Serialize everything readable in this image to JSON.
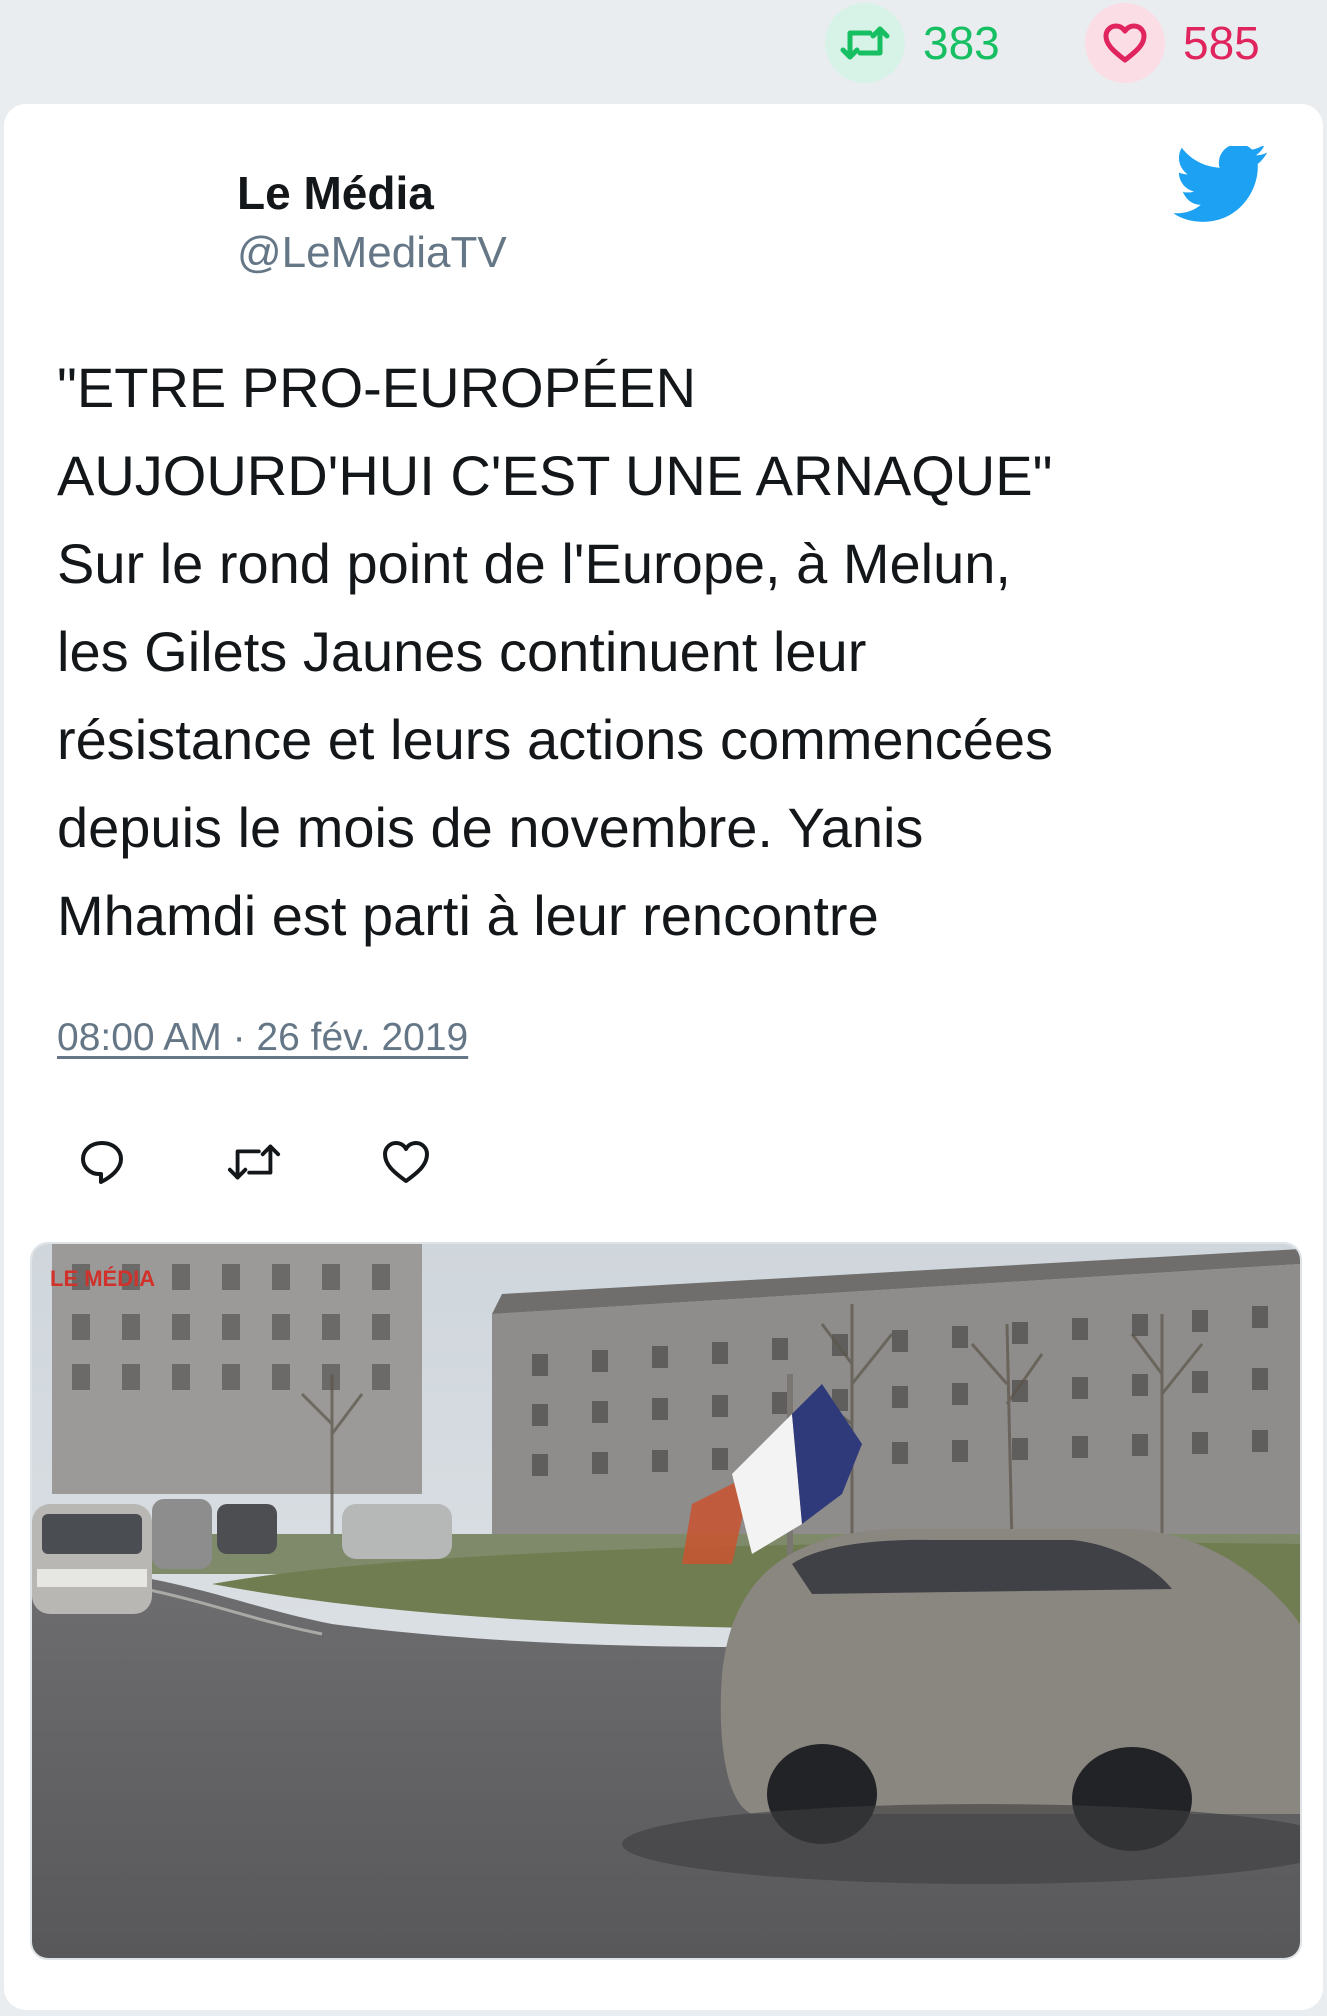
{
  "stats": {
    "retweets": "383",
    "likes": "585"
  },
  "tweet": {
    "author_name": "Le Média",
    "author_handle": "@LeMediaTV",
    "text_lines": [
      "\"ETRE PRO-EUROPÉEN",
      "AUJOURD'HUI C'EST UNE ARNAQUE\"",
      "Sur le rond point de l'Europe, à Melun,",
      "les Gilets Jaunes continuent leur",
      "résistance et leurs actions commencées",
      "depuis le mois de novembre. Yanis",
      "Mhamdi est parti à leur rencontre"
    ],
    "timestamp": "08:00 AM · 26 fév. 2019"
  },
  "media": {
    "watermark": "LE MÉDIA",
    "description_icon": "video-thumbnail"
  },
  "icons": {
    "retweet": "retweet-icon",
    "like": "heart-icon",
    "reply": "reply-icon",
    "brand": "twitter-bird-icon"
  },
  "colors": {
    "retweet_green": "#17bf63",
    "like_red": "#e0245e",
    "twitter_blue": "#1da1f2",
    "muted_text": "#657786",
    "primary_text": "#14171a"
  }
}
